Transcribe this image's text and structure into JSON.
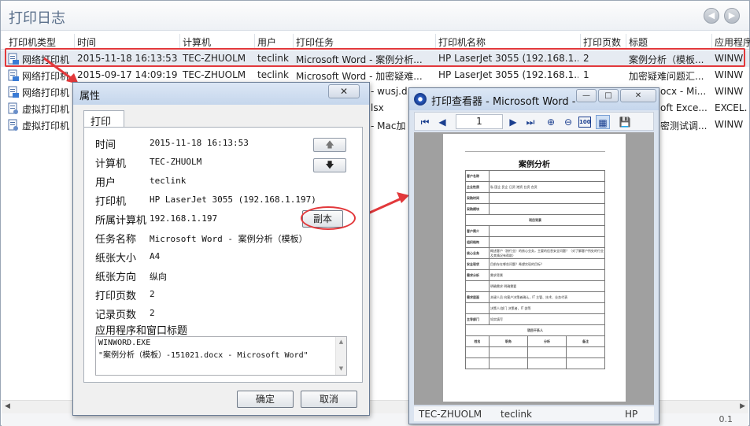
{
  "main": {
    "title": "打印日志",
    "columns": [
      "打印机类型",
      "时间",
      "计算机",
      "用户",
      "打印任务",
      "打印机名称",
      "打印页数",
      "标题",
      "应用程序"
    ],
    "rows": [
      {
        "type": "网络打印机",
        "time": "2015-11-18 16:13:53",
        "computer": "TEC-ZHUOLM",
        "user": "teclink",
        "task": "Microsoft Word - 案例分析...",
        "printer": "HP LaserJet 3055 (192.168.1...",
        "pages": "2",
        "title": "案例分析（模板...",
        "app": "WINW"
      },
      {
        "type": "网络打印机",
        "time": "2015-09-17 14:09:19",
        "computer": "TEC-ZHUOLM",
        "user": "teclink",
        "task": "Microsoft Word - 加密疑难...",
        "printer": "HP LaserJet 3055 (192.168.1...",
        "pages": "1",
        "title": "加密疑难问题汇...",
        "app": "WINW"
      },
      {
        "type": "网络打印机",
        "task_tail": "- wusj.d",
        "title_tail": "ocx - Mi...",
        "app": "WINW"
      },
      {
        "type": "虚拟打印机",
        "task_tail": "lsx",
        "title_tail": "oft Exce...",
        "app": "EXCEL."
      },
      {
        "type": "虚拟打印机",
        "task_tail": "- Mac加",
        "title_tail": "密测试调...",
        "app": "WINW"
      }
    ],
    "status_right": "0.1"
  },
  "properties_dialog": {
    "title": "属性",
    "close_label": "✕",
    "tab_label": "打印",
    "fields": [
      {
        "label": "时间",
        "value": "2015-11-18 16:13:53"
      },
      {
        "label": "计算机",
        "value": "TEC-ZHUOLM"
      },
      {
        "label": "用户",
        "value": "teclink"
      },
      {
        "label": "打印机",
        "value": "HP LaserJet 3055 (192.168.1.197)"
      },
      {
        "label": "所属计算机",
        "value": "192.168.1.197"
      },
      {
        "label": "任务名称",
        "value": "Microsoft Word - 案例分析（模板）"
      },
      {
        "label": "纸张大小",
        "value": "A4"
      },
      {
        "label": "纸张方向",
        "value": "纵向"
      },
      {
        "label": "打印页数",
        "value": "2"
      },
      {
        "label": "记录页数",
        "value": "2"
      }
    ],
    "app_title_label": "应用程序和窗口标题",
    "app_title_lines": [
      "WINWORD.EXE",
      "\"案例分析（模板）-151021.docx - Microsoft Word\""
    ],
    "copy_button": "副本",
    "ok_button": "确定",
    "cancel_button": "取消"
  },
  "viewer": {
    "title": "打印查看器 - Microsoft Word -",
    "page_number": "1",
    "zoom_label": "100",
    "document": {
      "title": "案例分析",
      "rows": [
        {
          "label": "客户名称",
          "value": ""
        },
        {
          "label": "企业性质",
          "value": "私  国企  民企  日资  港资  台资  合资"
        },
        {
          "label": "采购时间",
          "value": ""
        },
        {
          "label": "采购模块",
          "value": ""
        },
        {
          "section": "项目背景"
        },
        {
          "label": "客户简介",
          "value": ""
        },
        {
          "label": "组织结构",
          "value": ""
        },
        {
          "label": "核心业务",
          "value": "概述客户（按行业）的核心业务，主要的信息安全问题？（对了解客户所处的行业及其情况有帮助）"
        },
        {
          "label": "安全现状",
          "value": "目前存在哪些问题？希望实现的目标？"
        },
        {
          "label": "需求分析",
          "value": "需求背景"
        },
        {
          "label": "",
          "value": "明确需求  明确需要"
        },
        {
          "label": "需求层面",
          "value": "关键人员  向客户决策者确认，IT 主管、技术、业务代表"
        },
        {
          "label": "",
          "value": "决策人/部门  决策者，IT 部等"
        },
        {
          "label": "主导部门",
          "value": "如实填写"
        },
        {
          "section": "项目干系人"
        },
        {
          "header": [
            "姓名",
            "职务",
            "分析",
            "备注"
          ]
        }
      ]
    },
    "status_computer": "TEC-ZHUOLM",
    "status_user": "teclink",
    "status_printer": "HP"
  },
  "colors": {
    "highlight": "#e2383b",
    "title_text": "#5a6f8a"
  }
}
